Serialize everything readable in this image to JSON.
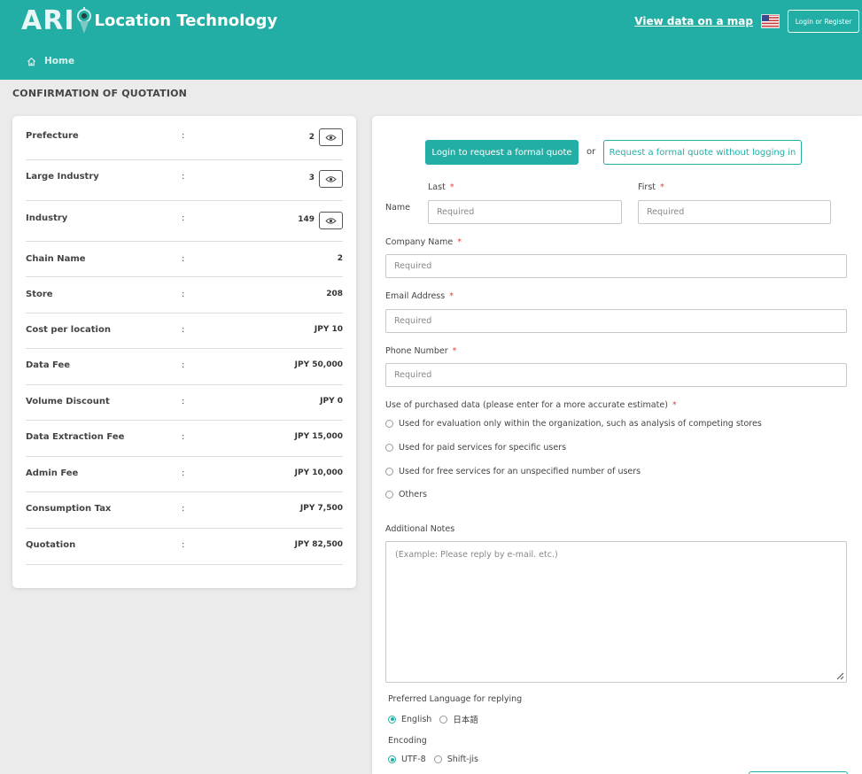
{
  "header": {
    "logo_letters": "ARI",
    "brand": "Location Technology",
    "view_map_link": "View data on a map",
    "flag_icon": "us-flag-icon",
    "login_register": "Login or Register",
    "nav_home": "Home",
    "bg_color": "#22aea5"
  },
  "page_title": "CONFIRMATION OF QUOTATION",
  "summary": {
    "separator": ":",
    "rows": [
      {
        "label": "Prefecture",
        "value": "2",
        "eye": true
      },
      {
        "label": "Large Industry",
        "value": "3",
        "eye": true
      },
      {
        "label": "Industry",
        "value": "149",
        "eye": true
      },
      {
        "label": "Chain Name",
        "value": "2",
        "eye": false
      },
      {
        "label": "Store",
        "value": "208",
        "eye": false
      },
      {
        "label": "Cost per location",
        "value": "JPY 10",
        "eye": false
      },
      {
        "label": "Data Fee",
        "value": "JPY 50,000",
        "eye": false
      },
      {
        "label": "Volume Discount",
        "value": "JPY 0",
        "eye": false
      },
      {
        "label": "Data Extraction Fee",
        "value": "JPY 15,000",
        "eye": false
      },
      {
        "label": "Admin Fee",
        "value": "JPY 10,000",
        "eye": false
      },
      {
        "label": "Consumption Tax",
        "value": "JPY 7,500",
        "eye": false
      },
      {
        "label": "Quotation",
        "value": "JPY 82,500",
        "eye": false
      }
    ]
  },
  "form": {
    "login_quote_button": "Login to request a formal quote",
    "or": "or",
    "no_login_button": "Request a formal quote without logging in",
    "name_label": "Name",
    "last_label": "Last",
    "first_label": "First",
    "required_mark": "*",
    "placeholder": "Required",
    "company_label": "Company Name",
    "email_label": "Email Address",
    "phone_label": "Phone Number",
    "use_label": "Use of purchased data (please enter for a more accurate estimate)",
    "use_options": [
      "Used for evaluation only within the organization, such as analysis of competing stores",
      "Used for paid services for specific users",
      "Used for free services for an unspecified number of users",
      "Others"
    ],
    "notes_label": "Additional Notes",
    "notes_placeholder": "(Example: Please reply by e-mail. etc.)",
    "language_label": "Preferred Language for replying",
    "language_options": [
      "English",
      "日本語"
    ],
    "language_selected": "English",
    "encoding_label": "Encoding",
    "encoding_options": [
      "UTF-8",
      "Shift-jis"
    ],
    "encoding_selected": "UTF-8"
  }
}
